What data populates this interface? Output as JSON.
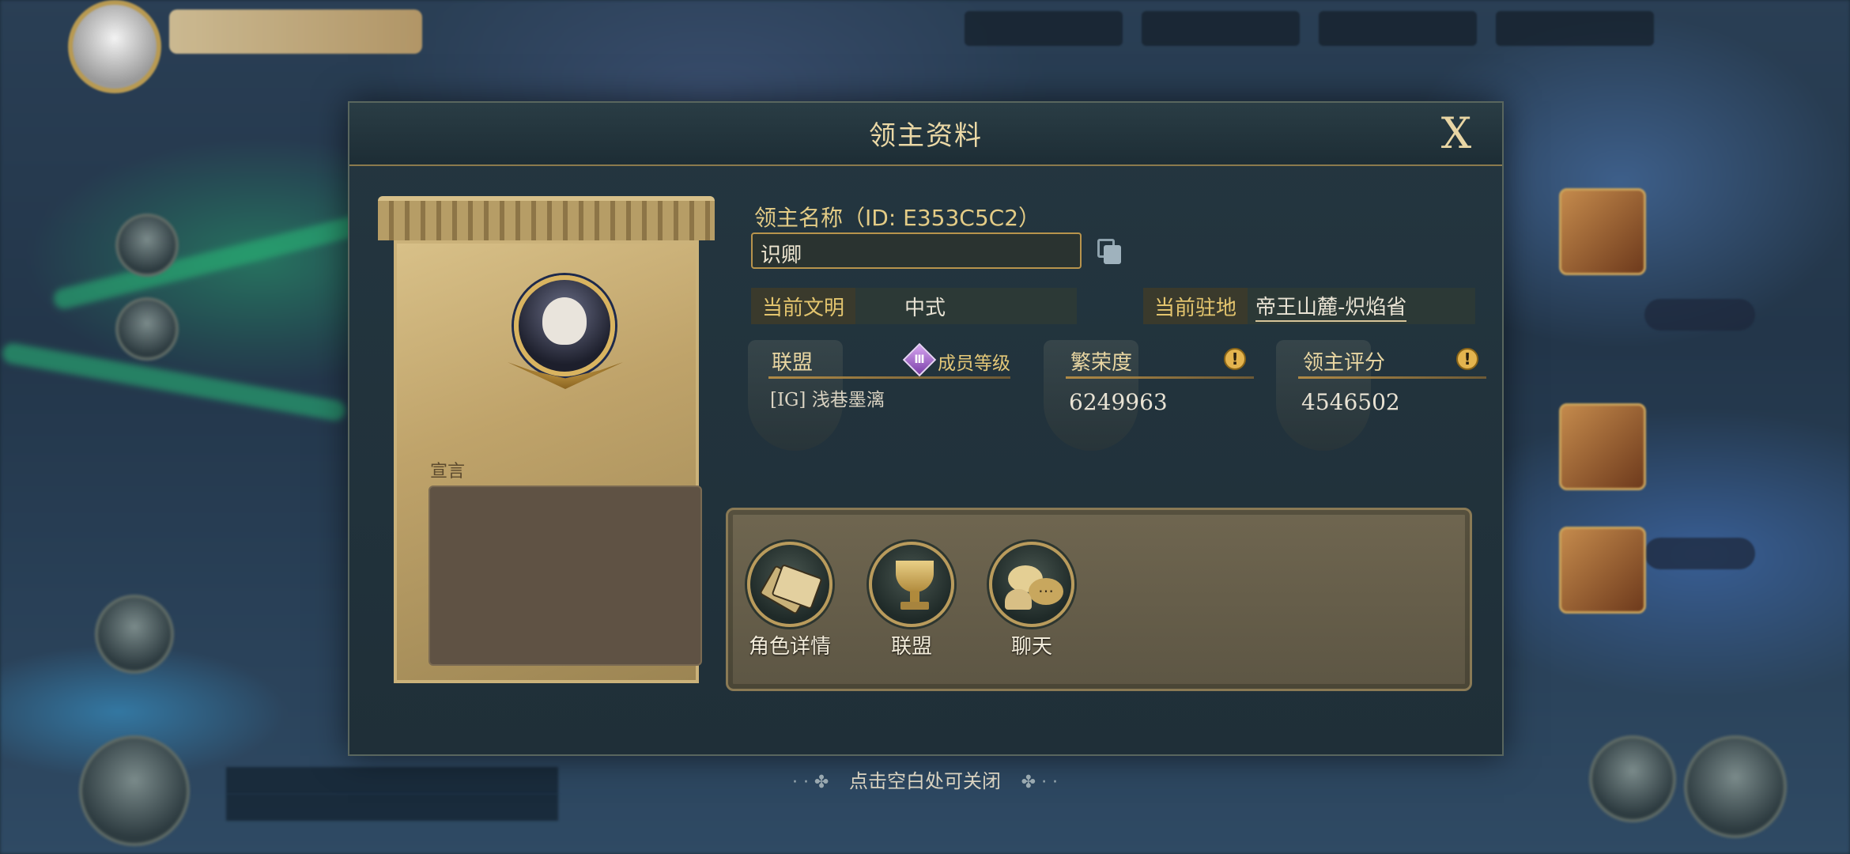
{
  "modal": {
    "title": "领主资料",
    "close_label": "X"
  },
  "profile": {
    "name_label": "领主名称（ID: E353C5C2）",
    "name_value": "识卿",
    "declaration_label": "宣言",
    "declaration_text": ""
  },
  "civilization": {
    "label": "当前文明",
    "value": "中式"
  },
  "location": {
    "label": "当前驻地",
    "value": "帝王山麓-炽焰省"
  },
  "alliance": {
    "label": "联盟",
    "rank_badge": "Ⅲ",
    "member_level_label": "成员等级",
    "value": "[IG] 浅巷墨漓"
  },
  "prosperity": {
    "label": "繁荣度",
    "info": "!",
    "value": "6249963"
  },
  "lord_score": {
    "label": "领主评分",
    "info": "!",
    "value": "4546502"
  },
  "actions": [
    {
      "label": "角色详情",
      "icon": "cards-icon"
    },
    {
      "label": "联盟",
      "icon": "trophy-icon"
    },
    {
      "label": "聊天",
      "icon": "chat-icon"
    }
  ],
  "hint": "点击空白处可关闭",
  "colors": {
    "gold_text": "#e4c878",
    "modal_bg": "#243640",
    "panel_gold": "#c9b279"
  }
}
